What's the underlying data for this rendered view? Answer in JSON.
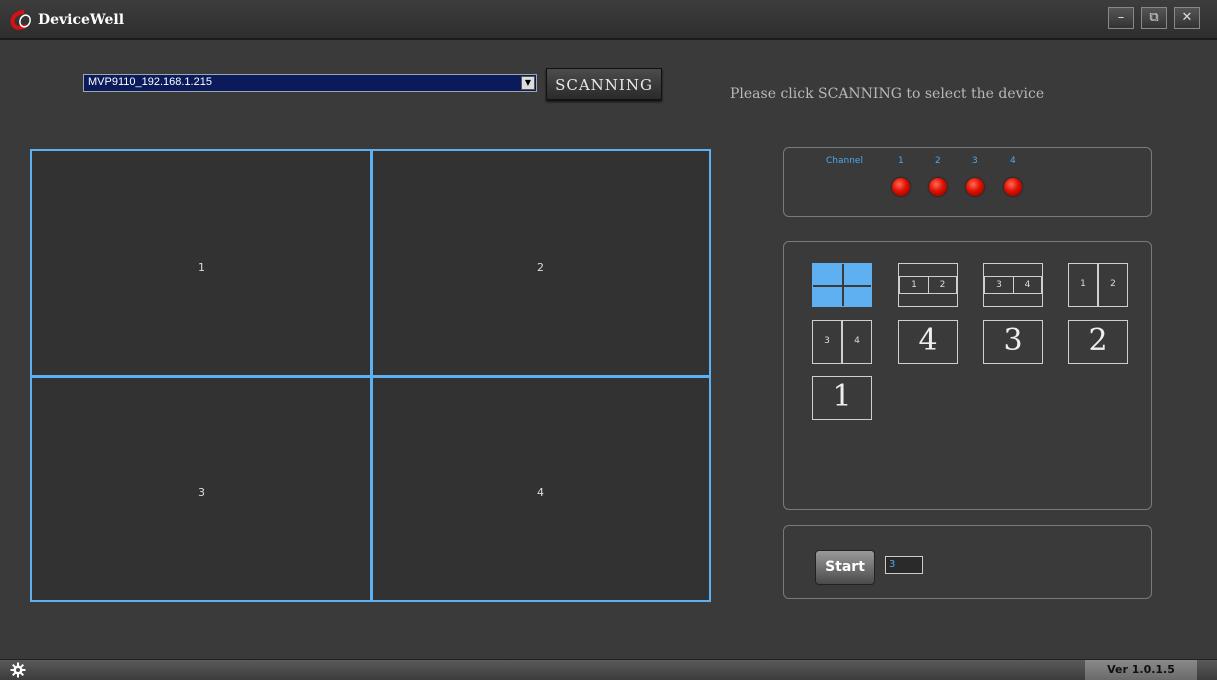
{
  "titlebar": {
    "app_title": "DeviceWell",
    "minimize_icon": "minimize-icon",
    "maximize_icon": "restore-icon",
    "close_icon": "close-icon",
    "min_glyph": "–",
    "max_glyph": "⧉",
    "close_glyph": "✕"
  },
  "toolbar": {
    "device_selected": "MVP9110_192.168.1.215",
    "dropdown_glyph": "▼",
    "scan_label": "SCANNING",
    "hint": "Please click SCANNING to select the device"
  },
  "preview": {
    "cells": [
      "1",
      "2",
      "3",
      "4"
    ],
    "border_color": "#5eb0f0"
  },
  "channels": {
    "label": "Channel",
    "numbers": [
      "1",
      "2",
      "3",
      "4"
    ],
    "led_color": "#e01000"
  },
  "layouts": {
    "quad_active_color": "#5eb0f0",
    "split_12": [
      "1",
      "2"
    ],
    "split_34": [
      "3",
      "4"
    ],
    "side_12": [
      "1",
      "2"
    ],
    "side_34": [
      "3",
      "4"
    ],
    "single": [
      "4",
      "3",
      "2",
      "1"
    ]
  },
  "start": {
    "label": "Start",
    "value": "3"
  },
  "statusbar": {
    "icon": "gear-icon",
    "version": "Ver 1.0.1.5"
  }
}
